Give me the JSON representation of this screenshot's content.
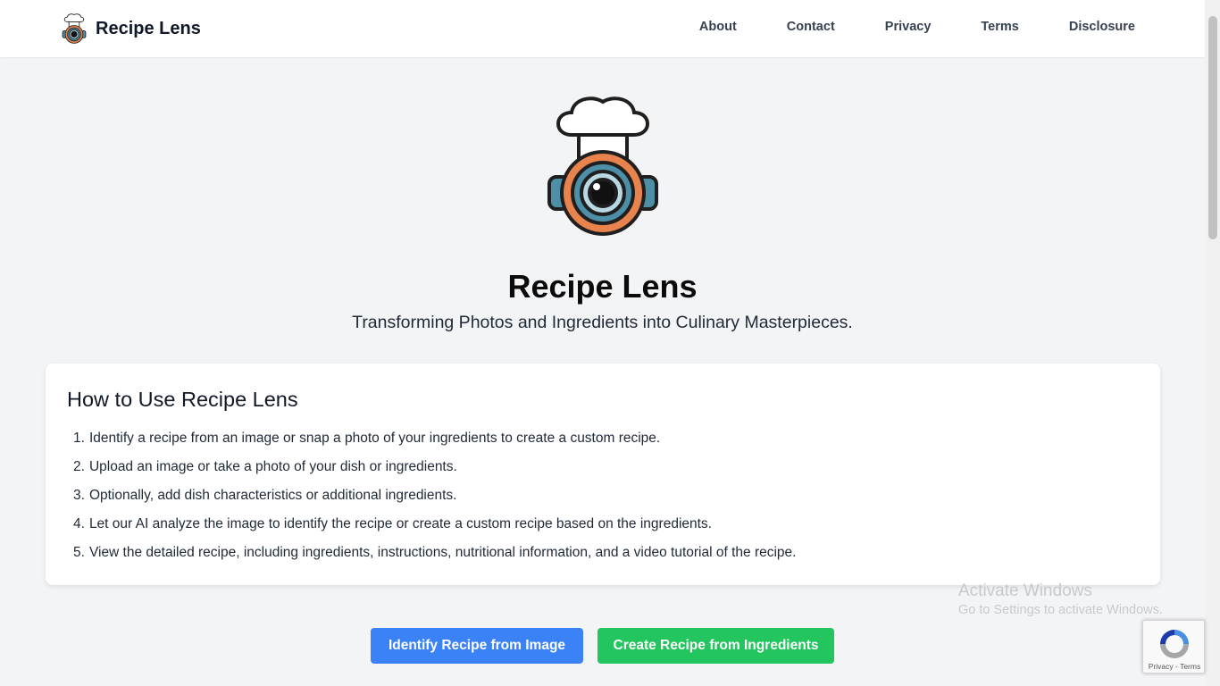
{
  "brand": {
    "name": "Recipe Lens"
  },
  "nav": {
    "links": [
      "About",
      "Contact",
      "Privacy",
      "Terms",
      "Disclosure"
    ]
  },
  "hero": {
    "title": "Recipe Lens",
    "subtitle": "Transforming Photos and Ingredients into Culinary Masterpieces."
  },
  "how_to": {
    "title": "How to Use Recipe Lens",
    "steps": [
      {
        "num": "1.",
        "text": "Identify a recipe from an image or snap a photo of your ingredients to create a custom recipe."
      },
      {
        "num": "2.",
        "text": "Upload an image or take a photo of your dish or ingredients."
      },
      {
        "num": "3.",
        "text": "Optionally, add dish characteristics or additional ingredients."
      },
      {
        "num": "4.",
        "text": "Let our AI analyze the image to identify the recipe or create a custom recipe based on the ingredients."
      },
      {
        "num": "5.",
        "text": "View the detailed recipe, including ingredients, instructions, nutritional information, and a video tutorial of the recipe."
      }
    ]
  },
  "buttons": {
    "identify": "Identify Recipe from Image",
    "create": "Create Recipe from Ingredients"
  },
  "watermark": {
    "title": "Activate Windows",
    "subtitle": "Go to Settings to activate Windows."
  },
  "recaptcha": {
    "privacy": "Privacy",
    "separator": " - ",
    "terms": "Terms"
  },
  "colors": {
    "primary_button": "#3b82f6",
    "secondary_button": "#22c55e",
    "page_background": "#f3f4f6",
    "logo_orange": "#e8834e",
    "logo_blue": "#4e8fa8"
  }
}
